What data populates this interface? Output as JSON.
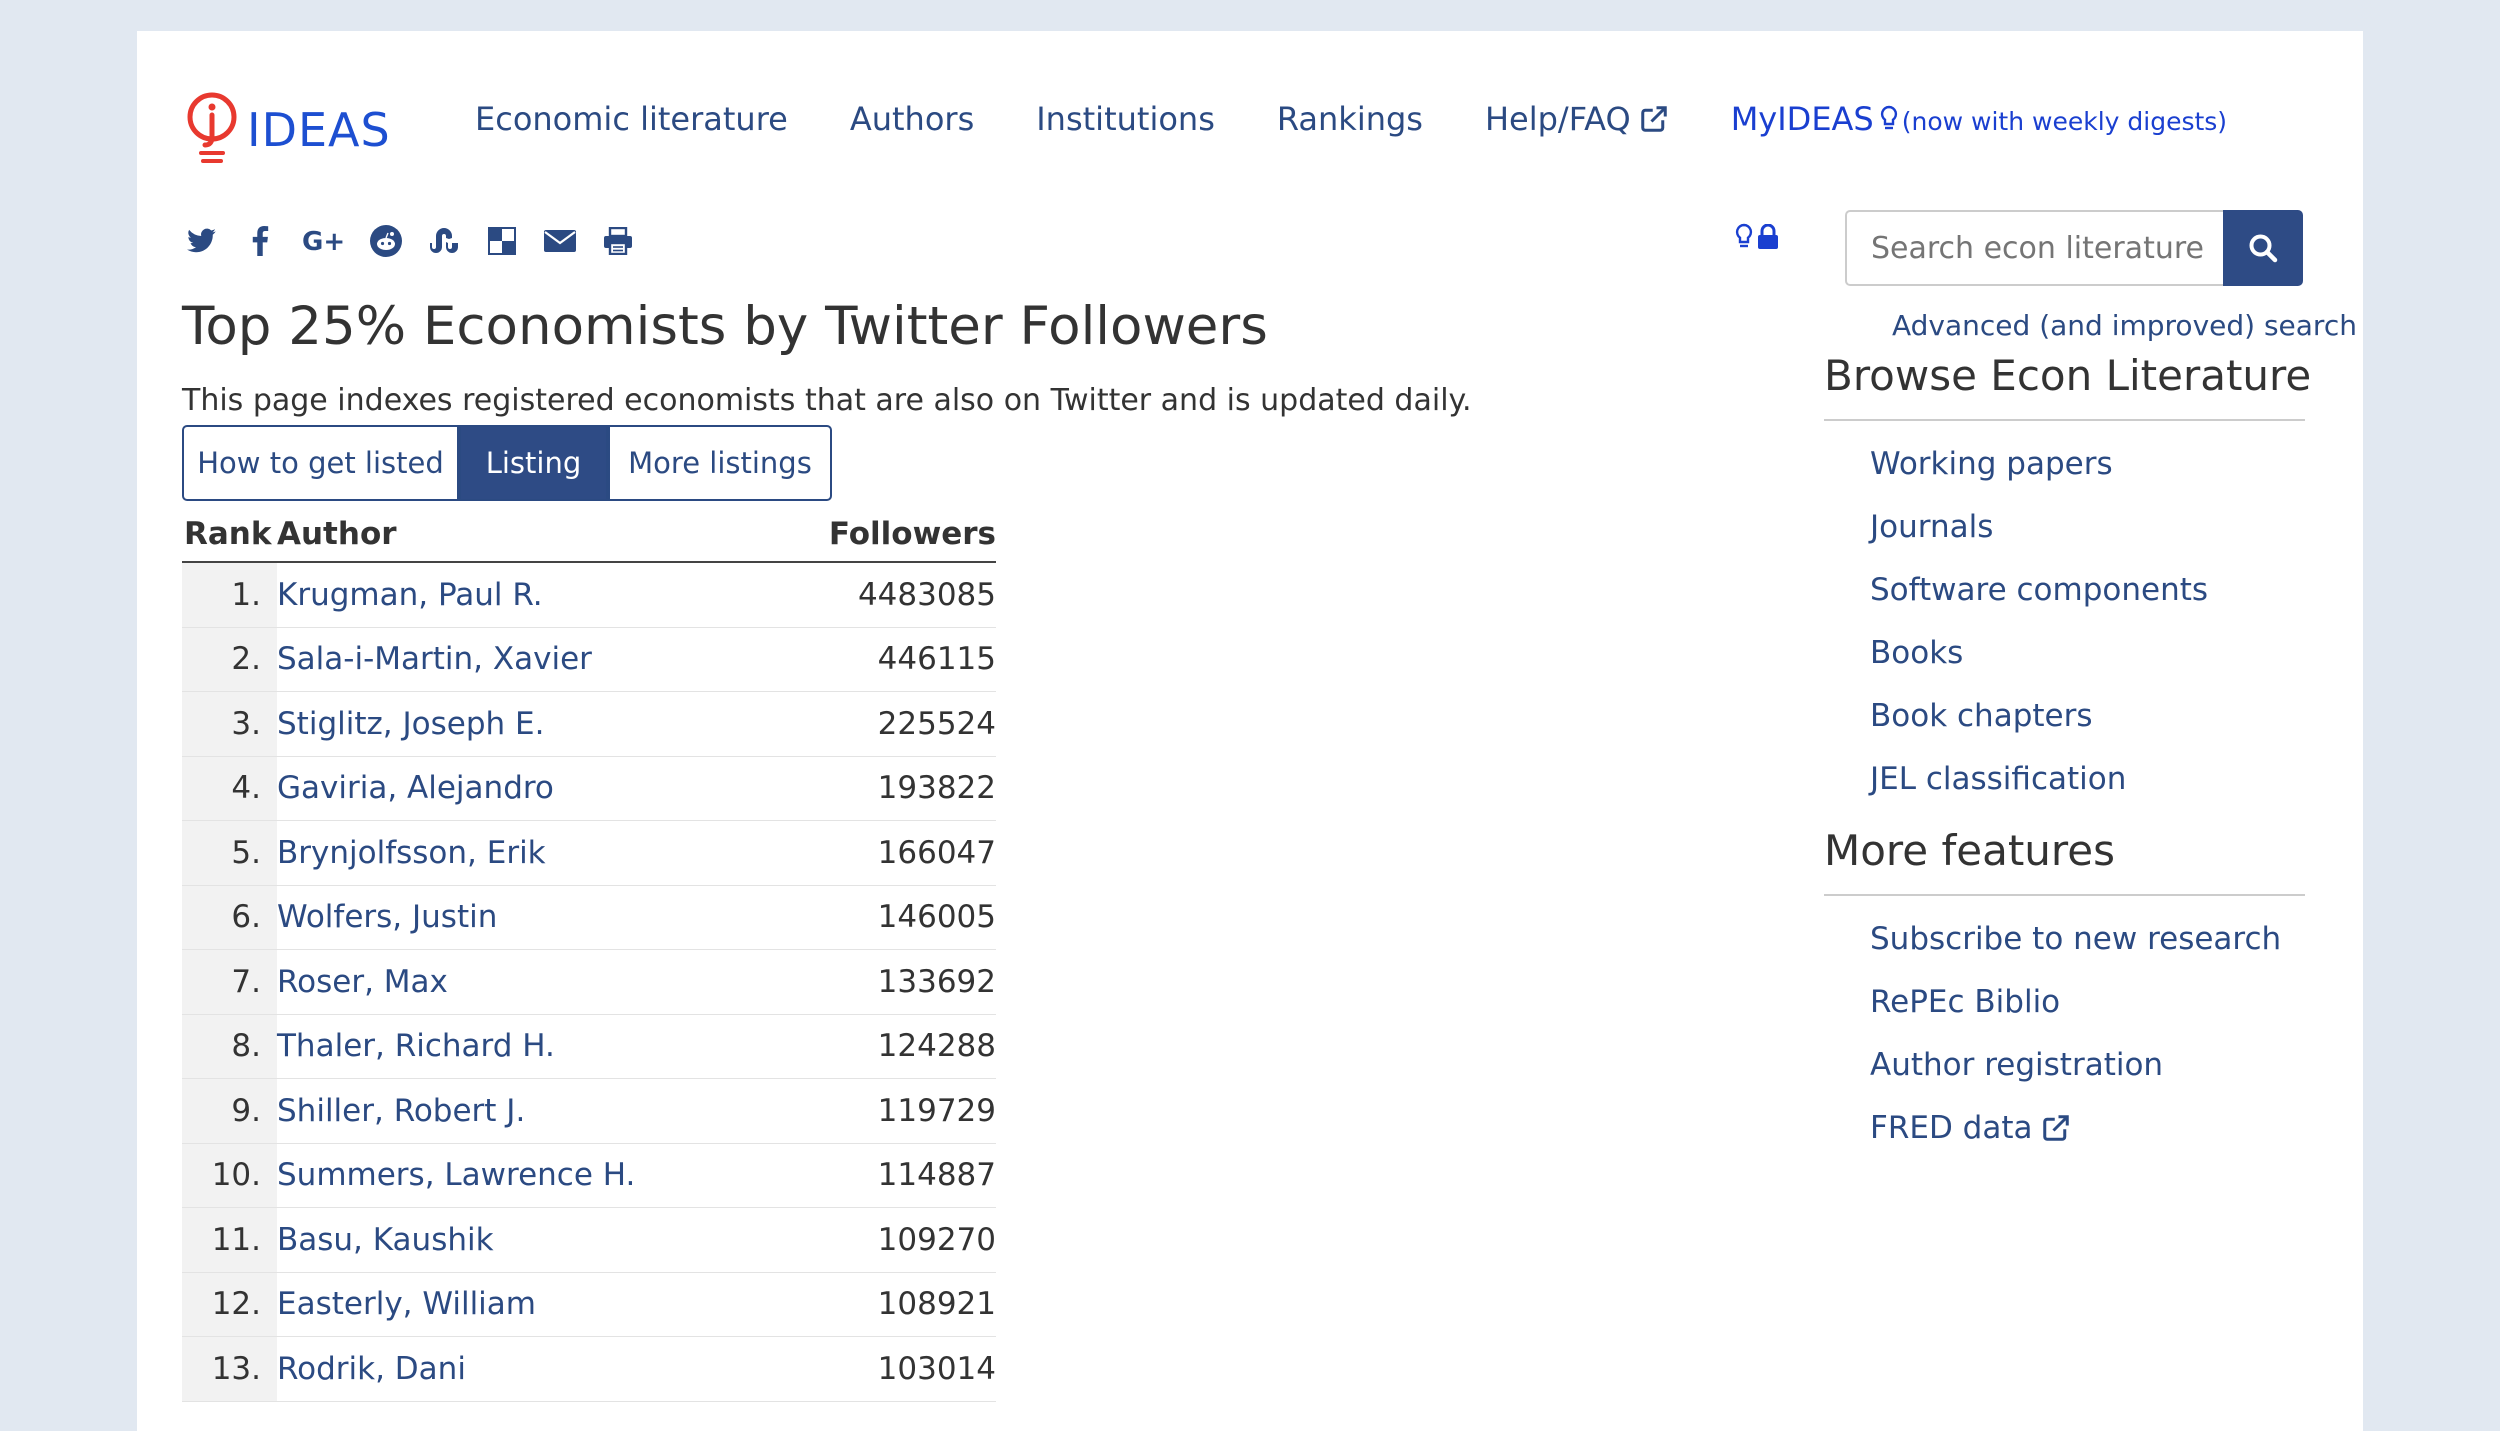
{
  "header": {
    "logo_text": "IDEAS",
    "nav": [
      {
        "label": "Economic literature"
      },
      {
        "label": "Authors"
      },
      {
        "label": "Institutions"
      },
      {
        "label": "Rankings"
      },
      {
        "label": "Help/FAQ"
      }
    ],
    "myideas": {
      "label": "MyIDEAS",
      "note": "(now with weekly digests)"
    }
  },
  "share_icons": [
    "twitter-icon",
    "facebook-icon",
    "google-plus-icon",
    "reddit-icon",
    "stumbleupon-icon",
    "delicious-icon",
    "email-icon",
    "print-icon"
  ],
  "page": {
    "title": "Top 25% Economists by Twitter Followers",
    "subtitle": "This page indexes registered economists that are also on Twitter and is updated daily."
  },
  "tabs": [
    {
      "label": "How to get listed",
      "active": false
    },
    {
      "label": "Listing",
      "active": true
    },
    {
      "label": "More listings",
      "active": false
    }
  ],
  "table": {
    "headers": {
      "rank": "Rank",
      "author": "Author",
      "followers": "Followers"
    },
    "rows": [
      {
        "rank": "1.",
        "author": "Krugman, Paul R.",
        "followers": "4483085"
      },
      {
        "rank": "2.",
        "author": "Sala-i-Martin, Xavier",
        "followers": "446115"
      },
      {
        "rank": "3.",
        "author": "Stiglitz, Joseph E.",
        "followers": "225524"
      },
      {
        "rank": "4.",
        "author": "Gaviria, Alejandro",
        "followers": "193822"
      },
      {
        "rank": "5.",
        "author": "Brynjolfsson, Erik",
        "followers": "166047"
      },
      {
        "rank": "6.",
        "author": "Wolfers, Justin",
        "followers": "146005"
      },
      {
        "rank": "7.",
        "author": "Roser, Max",
        "followers": "133692"
      },
      {
        "rank": "8.",
        "author": "Thaler, Richard H.",
        "followers": "124288"
      },
      {
        "rank": "9.",
        "author": "Shiller, Robert J.",
        "followers": "119729"
      },
      {
        "rank": "10.",
        "author": "Summers, Lawrence H.",
        "followers": "114887"
      },
      {
        "rank": "11.",
        "author": "Basu, Kaushik",
        "followers": "109270"
      },
      {
        "rank": "12.",
        "author": "Easterly, William",
        "followers": "108921"
      },
      {
        "rank": "13.",
        "author": "Rodrik, Dani",
        "followers": "103014"
      }
    ]
  },
  "sidebar": {
    "search": {
      "placeholder": "Search econ literature",
      "advanced": "Advanced (and improved) search"
    },
    "browse": {
      "title": "Browse Econ Literature",
      "items": [
        "Working papers",
        "Journals",
        "Software components",
        "Books",
        "Book chapters",
        "JEL classification"
      ]
    },
    "more": {
      "title": "More features",
      "items": [
        "Subscribe to new research",
        "RePEc Biblio",
        "Author registration",
        "FRED data"
      ]
    }
  },
  "colors": {
    "link": "#2b4a82",
    "accent": "#2e4b85",
    "logo_blue": "#1d4fd1",
    "logo_red": "#e8392f",
    "background": "#e1e8f1"
  }
}
